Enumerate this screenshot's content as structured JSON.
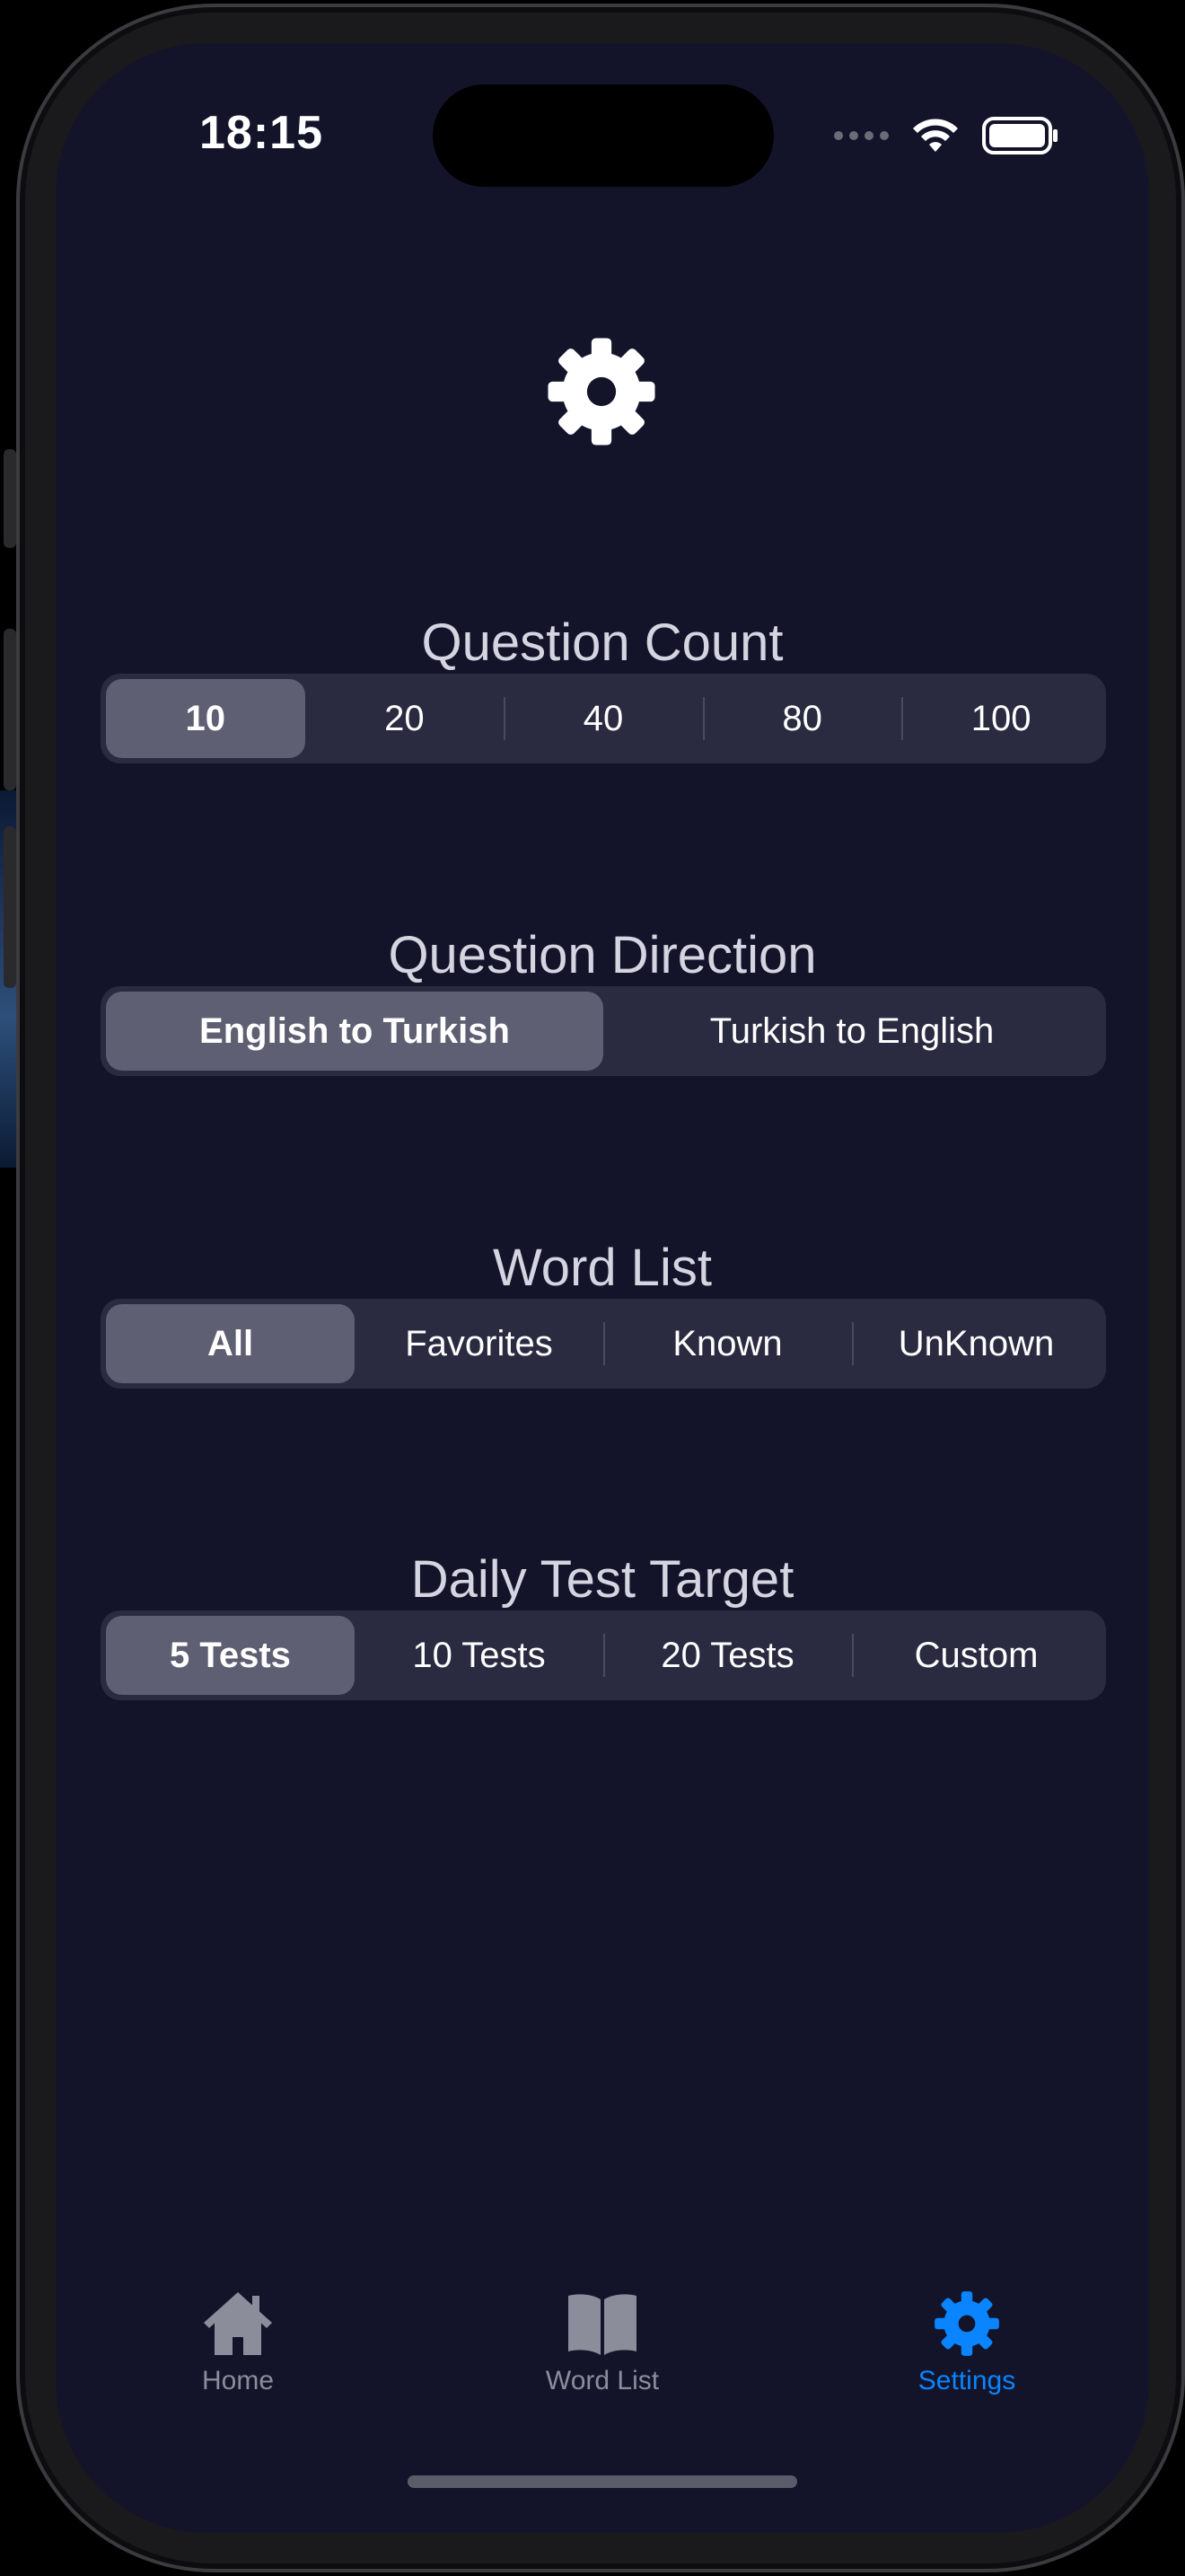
{
  "status_bar": {
    "time": "18:15"
  },
  "colors": {
    "background": "#13142a",
    "segment_track": "#2a2b40",
    "segment_selected": "#5e5f72",
    "accent": "#0a84ff",
    "tab_inactive": "#8c8d9a"
  },
  "header": {
    "icon": "gear-icon"
  },
  "sections": [
    {
      "title": "Question Count",
      "options": [
        "10",
        "20",
        "40",
        "80",
        "100"
      ],
      "selected": "10"
    },
    {
      "title": "Question Direction",
      "options": [
        "English to Turkish",
        "Turkish to English"
      ],
      "selected": "English to Turkish"
    },
    {
      "title": "Word List",
      "options": [
        "All",
        "Favorites",
        "Known",
        "UnKnown"
      ],
      "selected": "All"
    },
    {
      "title": "Daily Test Target",
      "options": [
        "5 Tests",
        "10 Tests",
        "20 Tests",
        "Custom"
      ],
      "selected": "5 Tests"
    }
  ],
  "tab_bar": {
    "items": [
      {
        "label": "Home",
        "icon": "house-icon"
      },
      {
        "label": "Word List",
        "icon": "book-icon"
      },
      {
        "label": "Settings",
        "icon": "gear-icon"
      }
    ],
    "active": "Settings"
  }
}
